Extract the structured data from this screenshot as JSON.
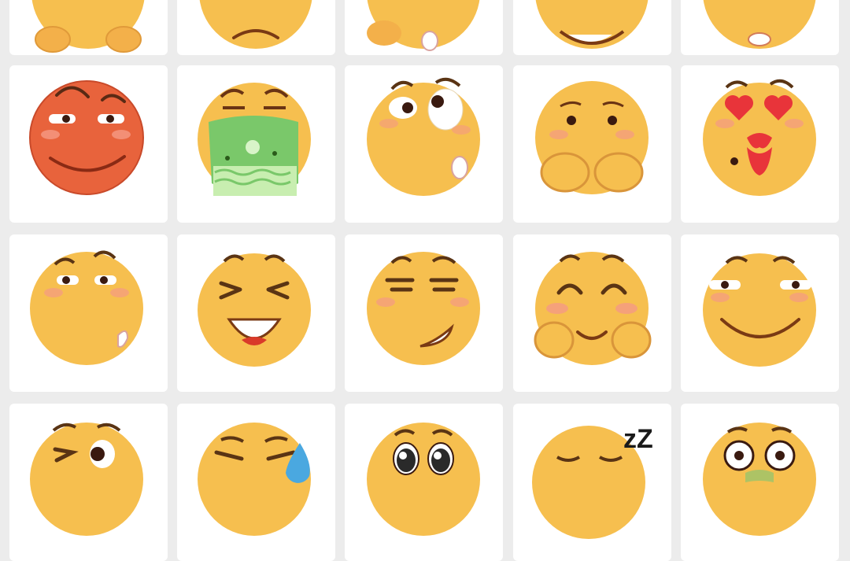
{
  "colors": {
    "background": "#ececec",
    "tile": "#ffffff",
    "face_yellow": "#f6bf4f",
    "face_red": "#e8633c",
    "blush": "#f59a84",
    "heart_red": "#e8343a"
  },
  "emoji_grid": {
    "columns": 5,
    "rows": [
      [
        "clap-emoji",
        "sad-emoji",
        "facepalm-emoji",
        "grin-emoji",
        "wow-emoji"
      ],
      [
        "sneer-emoji",
        "vomit-emoji",
        "side-eye-emoji",
        "shy-emoji",
        "kiss-emoji"
      ],
      [
        "smirk-emoji",
        "laugh-emoji",
        "smug-emoji",
        "blush-emoji",
        "slight-smile-emoji"
      ],
      [
        "wink-emoji",
        "sweat-emoji",
        "puppy-eyes-emoji",
        "sleep-emoji",
        "shocked-emoji"
      ]
    ]
  },
  "sleep_symbol": "zZ"
}
